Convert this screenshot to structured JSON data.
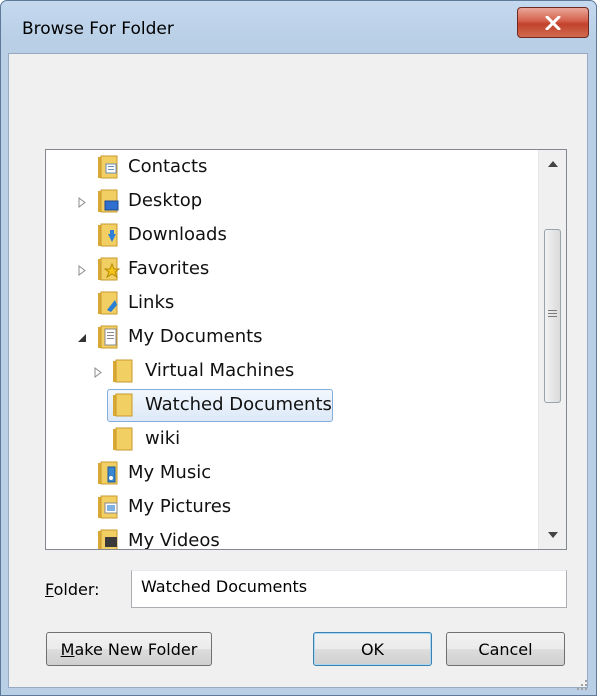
{
  "dialog": {
    "title": "Browse For Folder",
    "close_glyph": "✕"
  },
  "tree": {
    "items": [
      {
        "label": "Contacts",
        "expander": "none",
        "icon": "contacts-folder-icon"
      },
      {
        "label": "Desktop",
        "expander": "collapsed",
        "icon": "desktop-folder-icon"
      },
      {
        "label": "Downloads",
        "expander": "none",
        "icon": "downloads-folder-icon"
      },
      {
        "label": "Favorites",
        "expander": "collapsed",
        "icon": "favorites-folder-icon"
      },
      {
        "label": "Links",
        "expander": "none",
        "icon": "links-folder-icon"
      },
      {
        "label": "My Documents",
        "expander": "expanded",
        "icon": "documents-folder-icon"
      },
      {
        "label": "Virtual Machines",
        "expander": "collapsed",
        "icon": "folder-icon"
      },
      {
        "label": "Watched Documents",
        "expander": "none",
        "icon": "folder-icon",
        "selected": true
      },
      {
        "label": "wiki",
        "expander": "none",
        "icon": "folder-icon"
      },
      {
        "label": "My Music",
        "expander": "none",
        "icon": "music-folder-icon"
      },
      {
        "label": "My Pictures",
        "expander": "none",
        "icon": "pictures-folder-icon"
      },
      {
        "label": "My Videos",
        "expander": "none",
        "icon": "videos-folder-icon"
      }
    ]
  },
  "folder_field": {
    "label_underlined": "F",
    "label_rest": "older:",
    "value": "Watched Documents"
  },
  "buttons": {
    "make_new_folder_underlined": "M",
    "make_new_folder_rest": "ake New Folder",
    "ok": "OK",
    "cancel": "Cancel"
  },
  "colors": {
    "selection_border": "#84acdd",
    "folder_yellow": "#f2cf63",
    "window_frame": "#b9cfe6"
  }
}
